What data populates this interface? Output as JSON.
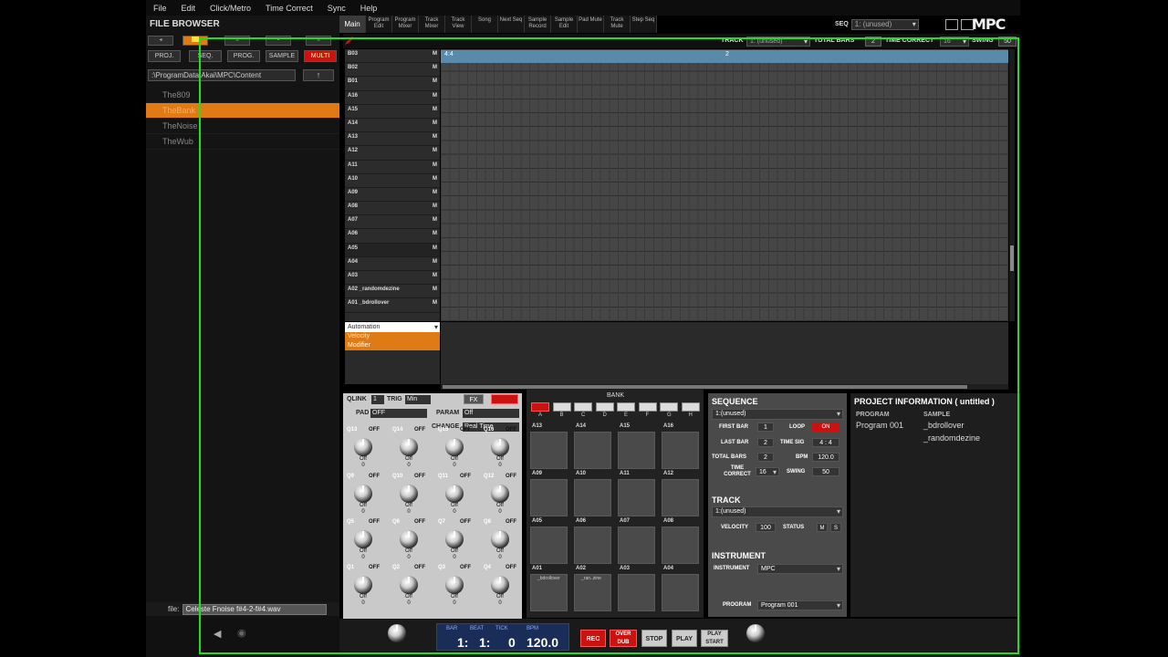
{
  "menubar": {
    "items": [
      "File",
      "Edit",
      "Click/Metro",
      "Time Correct",
      "Sync",
      "Help"
    ]
  },
  "mode_tabs": [
    {
      "label": "Main",
      "active": true
    },
    {
      "label": "Program Edit"
    },
    {
      "label": "Program Mixer"
    },
    {
      "label": "Track Mixer"
    },
    {
      "label": "Track View"
    },
    {
      "label": "Song"
    },
    {
      "label": "Next Seq"
    },
    {
      "label": "Sample Record"
    },
    {
      "label": "Sample Edit"
    },
    {
      "label": "Pad Mute"
    },
    {
      "label": "Track Mute"
    },
    {
      "label": "Step Seq"
    }
  ],
  "header": {
    "seq_label": "SEQ",
    "seq_value": "1: (unused)",
    "logo": "MPC"
  },
  "file_browser": {
    "title": "FILE BROWSER",
    "buttons": [
      "PROJ.",
      "SEQ.",
      "PROG.",
      "SAMPLE",
      "MULTI"
    ],
    "path": ":\\ProgramData\\Akai\\MPC\\Content",
    "up": "↑",
    "items": [
      {
        "name": "The809"
      },
      {
        "name": "TheBank",
        "selected": true
      },
      {
        "name": "TheNoise"
      },
      {
        "name": "TheWub"
      }
    ],
    "file_label": "file:",
    "file_value": "Celeste Fnoise f#4-2-f#4.wav"
  },
  "seq_bar": {
    "track_label": "TRACK",
    "track_value": "1: (unused)",
    "total_bars_label": "TOTAL BARS",
    "total_bars_value": "2",
    "time_correct_label": "TIME CORRECT",
    "time_correct_value": "16",
    "swing_label": "SWING",
    "swing_value": "50"
  },
  "ruler": {
    "marks": [
      "4:4",
      "2"
    ]
  },
  "pad_rows": [
    {
      "name": "B03",
      "mute": "M"
    },
    {
      "name": "B02",
      "mute": "M"
    },
    {
      "name": "B01",
      "mute": "M"
    },
    {
      "name": "A16",
      "mute": "M"
    },
    {
      "name": "A15",
      "mute": "M"
    },
    {
      "name": "A14",
      "mute": "M"
    },
    {
      "name": "A13",
      "mute": "M"
    },
    {
      "name": "A12",
      "mute": "M"
    },
    {
      "name": "A11",
      "mute": "M"
    },
    {
      "name": "A10",
      "mute": "M"
    },
    {
      "name": "A09",
      "mute": "M"
    },
    {
      "name": "A08",
      "mute": "M"
    },
    {
      "name": "A07",
      "mute": "M"
    },
    {
      "name": "A06",
      "mute": "M"
    },
    {
      "name": "A05",
      "mute": "M"
    },
    {
      "name": "A04",
      "mute": "M"
    },
    {
      "name": "A03",
      "mute": "M"
    },
    {
      "name": "A02 _randomdezine",
      "mute": "M"
    },
    {
      "name": "A01 _bdrollover",
      "mute": "M"
    }
  ],
  "automation": {
    "header": "Automation",
    "items": [
      "Velocity",
      "Modifier"
    ]
  },
  "qlink": {
    "qlink_label": "QLINK",
    "qlink_value": "1",
    "trig_label": "TRIG",
    "trig_value": "Min",
    "fx_label": "FX",
    "pad_label": "PAD",
    "pad_value": "OFF",
    "param_label": "PARAM",
    "param_value": "Off",
    "change_label": "CHANGE",
    "change_value": "Real Time",
    "knobs": [
      {
        "tag": "Q13",
        "state": "OFF",
        "val": "Off",
        "num": "0"
      },
      {
        "tag": "Q14",
        "state": "OFF",
        "val": "Off",
        "num": "0"
      },
      {
        "tag": "Q15",
        "state": "OFF",
        "val": "Off",
        "num": "0"
      },
      {
        "tag": "Q16",
        "state": "OFF",
        "val": "Off",
        "num": "0"
      },
      {
        "tag": "Q9",
        "state": "OFF",
        "val": "Off",
        "num": "0"
      },
      {
        "tag": "Q10",
        "state": "OFF",
        "val": "Off",
        "num": "0"
      },
      {
        "tag": "Q11",
        "state": "OFF",
        "val": "Off",
        "num": "0"
      },
      {
        "tag": "Q12",
        "state": "OFF",
        "val": "Off",
        "num": "0"
      },
      {
        "tag": "Q5",
        "state": "OFF",
        "val": "Off",
        "num": "0"
      },
      {
        "tag": "Q6",
        "state": "OFF",
        "val": "Off",
        "num": "0"
      },
      {
        "tag": "Q7",
        "state": "OFF",
        "val": "Off",
        "num": "0"
      },
      {
        "tag": "Q8",
        "state": "OFF",
        "val": "Off",
        "num": "0"
      },
      {
        "tag": "Q1",
        "state": "OFF",
        "val": "Off",
        "num": "0"
      },
      {
        "tag": "Q2",
        "state": "OFF",
        "val": "Off",
        "num": "0"
      },
      {
        "tag": "Q3",
        "state": "OFF",
        "val": "Off",
        "num": "0"
      },
      {
        "tag": "Q4",
        "state": "OFF",
        "val": "Off",
        "num": "0"
      }
    ]
  },
  "pads": {
    "bank_label": "BANK",
    "banks": [
      "A",
      "B",
      "C",
      "D",
      "E",
      "F",
      "G",
      "H"
    ],
    "grid": [
      {
        "name": "A13",
        "sub": ""
      },
      {
        "name": "A14",
        "sub": ""
      },
      {
        "name": "A15",
        "sub": ""
      },
      {
        "name": "A16",
        "sub": ""
      },
      {
        "name": "A09",
        "sub": ""
      },
      {
        "name": "A10",
        "sub": ""
      },
      {
        "name": "A11",
        "sub": ""
      },
      {
        "name": "A12",
        "sub": ""
      },
      {
        "name": "A05",
        "sub": ""
      },
      {
        "name": "A06",
        "sub": ""
      },
      {
        "name": "A07",
        "sub": ""
      },
      {
        "name": "A08",
        "sub": ""
      },
      {
        "name": "A01",
        "sub": "_bdrollover"
      },
      {
        "name": "A02",
        "sub": "_ran..zine"
      },
      {
        "name": "A03",
        "sub": ""
      },
      {
        "name": "A04",
        "sub": ""
      }
    ]
  },
  "sequence": {
    "title": "SEQUENCE",
    "selected": "1:(unused)",
    "first_bar_label": "FIRST BAR",
    "first_bar": "1",
    "loop_label": "LOOP",
    "loop_value": "ON",
    "last_bar_label": "LAST BAR",
    "last_bar": "2",
    "time_sig_label": "TIME SIG",
    "time_sig": "4 : 4",
    "total_bars_label": "TOTAL BARS",
    "total_bars": "2",
    "bpm_label": "BPM",
    "bpm": "120.0",
    "time_correct_label": "TIME CORRECT",
    "time_correct": "16",
    "swing_label": "SWING",
    "swing": "50"
  },
  "track": {
    "title": "TRACK",
    "selected": "1:(unused)",
    "velocity_label": "VELOCITY",
    "velocity": "100",
    "status_label": "STATUS",
    "m": "M",
    "s": "S"
  },
  "instrument": {
    "title": "INSTRUMENT",
    "inst_label": "INSTRUMENT",
    "inst_value": "MPC",
    "program_label": "PROGRAM",
    "program_value": "Program 001"
  },
  "project": {
    "title": "PROJECT INFORMATION  ( untitled )",
    "program_header": "PROGRAM",
    "sample_header": "SAMPLE",
    "program": "Program 001",
    "samples": [
      "_bdrollover",
      "_randomdezine"
    ]
  },
  "transport": {
    "bar_label": "BAR",
    "beat_label": "BEAT",
    "tick_label": "TICK",
    "bpm_label": "BPM",
    "bar": "1:",
    "beat": "1:",
    "tick": "0",
    "bpm": "120.0",
    "rec": "REC",
    "overdub": "OVER DUB",
    "stop": "STOP",
    "play": "PLAY",
    "play_start": "PLAY START"
  }
}
